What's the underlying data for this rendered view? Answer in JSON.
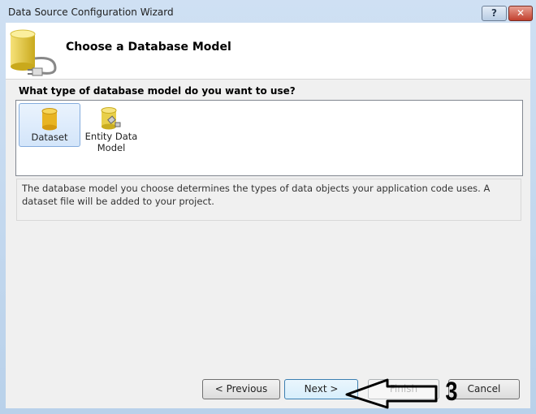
{
  "window": {
    "title": "Data Source Configuration Wizard",
    "help_label": "?",
    "close_label": "✕"
  },
  "header": {
    "title": "Choose a Database Model",
    "icon": "database-plug-icon"
  },
  "prompt": "What type of database model do you want to use?",
  "models": [
    {
      "label": "Dataset",
      "icon": "dataset-cylinder-icon",
      "selected": true
    },
    {
      "label": "Entity Data Model",
      "icon": "entity-data-model-icon",
      "selected": false
    }
  ],
  "description": "The database model you choose determines the types of data objects your application code uses. A dataset file will be added to your project.",
  "buttons": {
    "previous": "< Previous",
    "next": "Next >",
    "finish": "Finish",
    "cancel": "Cancel"
  },
  "annotation": {
    "label": "3",
    "icon": "left-arrow-annotation"
  }
}
